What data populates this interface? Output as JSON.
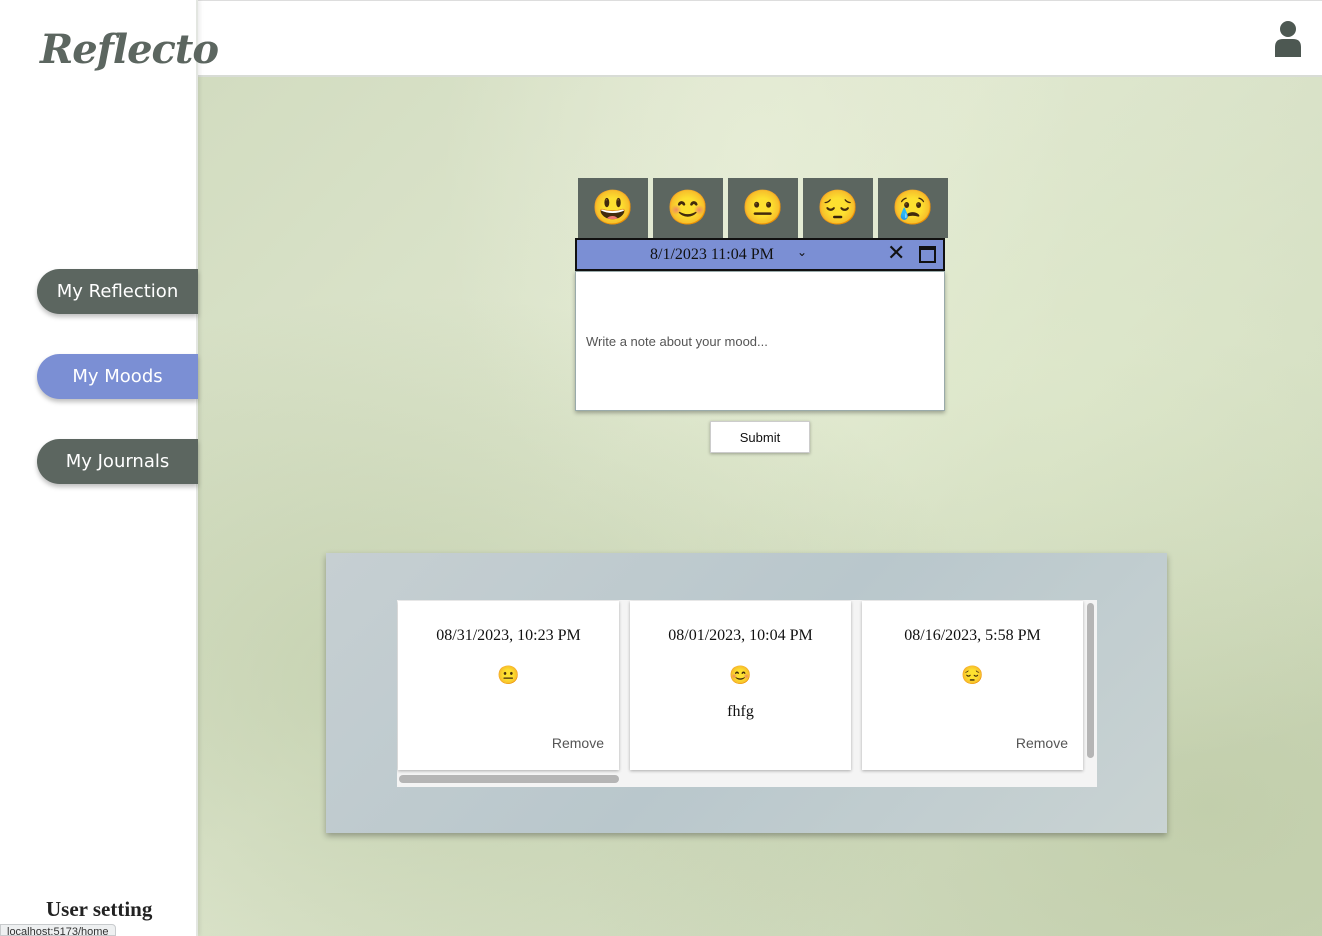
{
  "app": {
    "logo": "Reflecto"
  },
  "sidebar": {
    "items": [
      {
        "label": "My Reflection"
      },
      {
        "label": "My Moods",
        "active": true
      },
      {
        "label": "My Journals"
      }
    ],
    "user_setting": "User setting"
  },
  "status_bar": {
    "url": "localhost:5173/home"
  },
  "colors": {
    "accent": "#7b8fd4",
    "nav": "#5c6660"
  },
  "mood_picker": {
    "options": [
      {
        "emoji": "😃",
        "icon": "grinning-face-icon"
      },
      {
        "emoji": "😊",
        "icon": "smiling-face-icon"
      },
      {
        "emoji": "😐",
        "icon": "neutral-face-icon"
      },
      {
        "emoji": "😔",
        "icon": "pensive-face-icon"
      },
      {
        "emoji": "😢",
        "icon": "crying-face-icon"
      }
    ],
    "datetime": "8/1/2023 11:04  PM",
    "note_placeholder": "Write a note about your mood...",
    "submit_label": "Submit"
  },
  "history": {
    "cards": [
      {
        "date": "08/31/2023, 10:23 PM",
        "emoji": "😐",
        "note": "",
        "remove_label": "Remove"
      },
      {
        "date": "08/01/2023, 10:04 PM",
        "emoji": "😊",
        "note": "fhfg",
        "remove_label": ""
      },
      {
        "date": "08/16/2023, 5:58 PM",
        "emoji": "😔",
        "note": "",
        "remove_label": "Remove"
      }
    ]
  }
}
